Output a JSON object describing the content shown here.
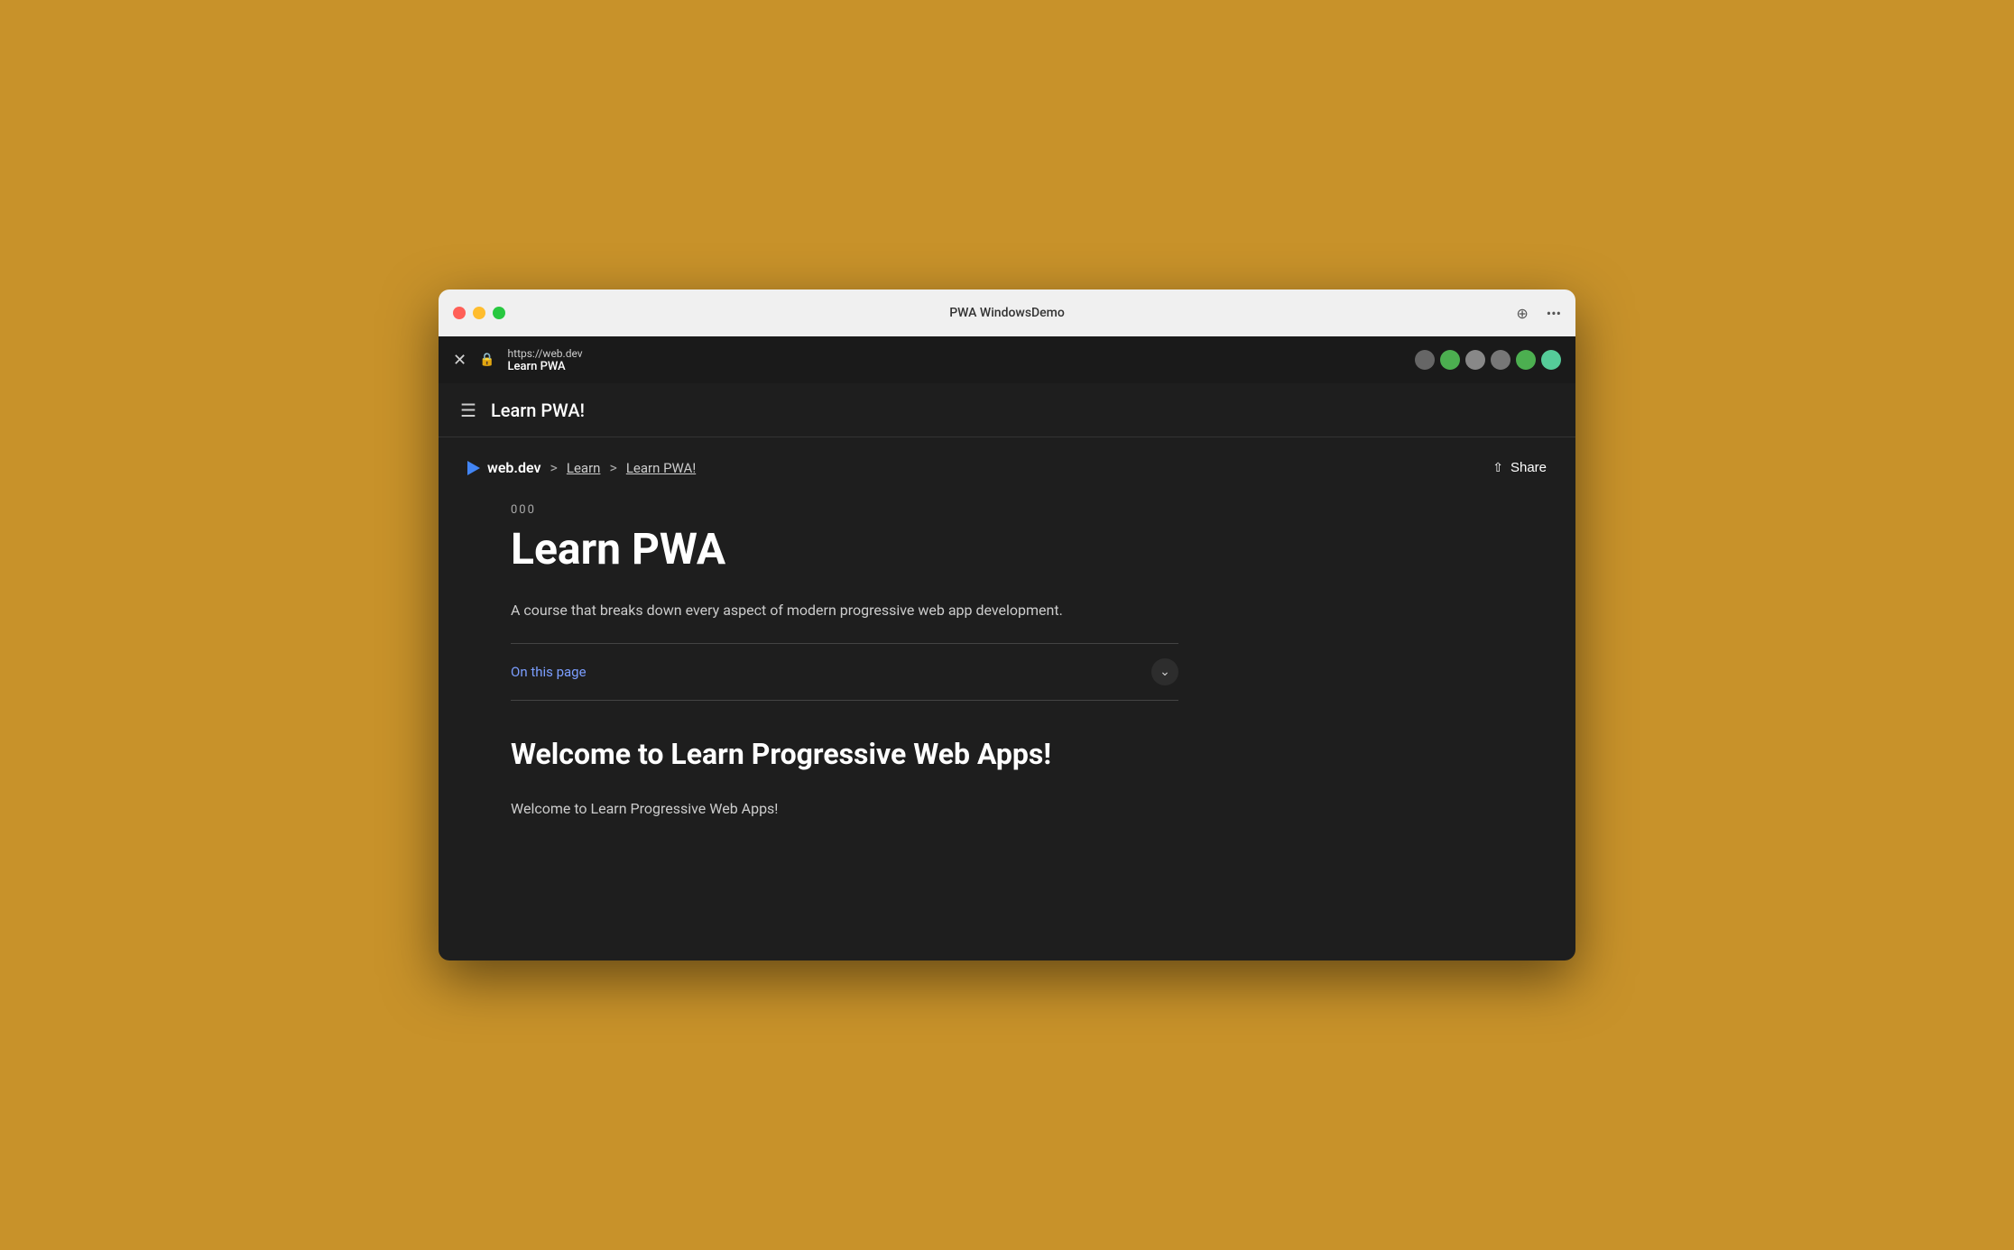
{
  "window": {
    "title": "PWA WindowsDemo"
  },
  "traffic_lights": {
    "close": "close",
    "minimize": "minimize",
    "maximize": "maximize"
  },
  "browser_bar": {
    "url": "https://web.dev",
    "page_title": "Learn PWA",
    "close_label": "✕",
    "lock_icon": "🔒"
  },
  "app_bar": {
    "title": "Learn PWA!",
    "hamburger": "☰"
  },
  "breadcrumb": {
    "logo_text": "web.dev",
    "separator1": ">",
    "link1": "Learn",
    "separator2": ">",
    "link2": "Learn PWA!"
  },
  "share": {
    "label": "Share",
    "icon": "⇧"
  },
  "article": {
    "number": "000",
    "title": "Learn PWA",
    "description": "A course that breaks down every aspect of modern progressive web app development.",
    "on_this_page": "On this page",
    "chevron": "⌄",
    "section_heading": "Welcome to Learn Progressive Web Apps!",
    "section_text": "Welcome to Learn Progressive Web Apps!"
  },
  "extensions": [
    {
      "color": "#888",
      "label": ""
    },
    {
      "color": "#4CAF50",
      "label": ""
    },
    {
      "color": "#999",
      "label": ""
    },
    {
      "color": "#777",
      "label": ""
    },
    {
      "color": "#4CAF50",
      "label": ""
    },
    {
      "color": "#5c9",
      "label": ""
    }
  ]
}
